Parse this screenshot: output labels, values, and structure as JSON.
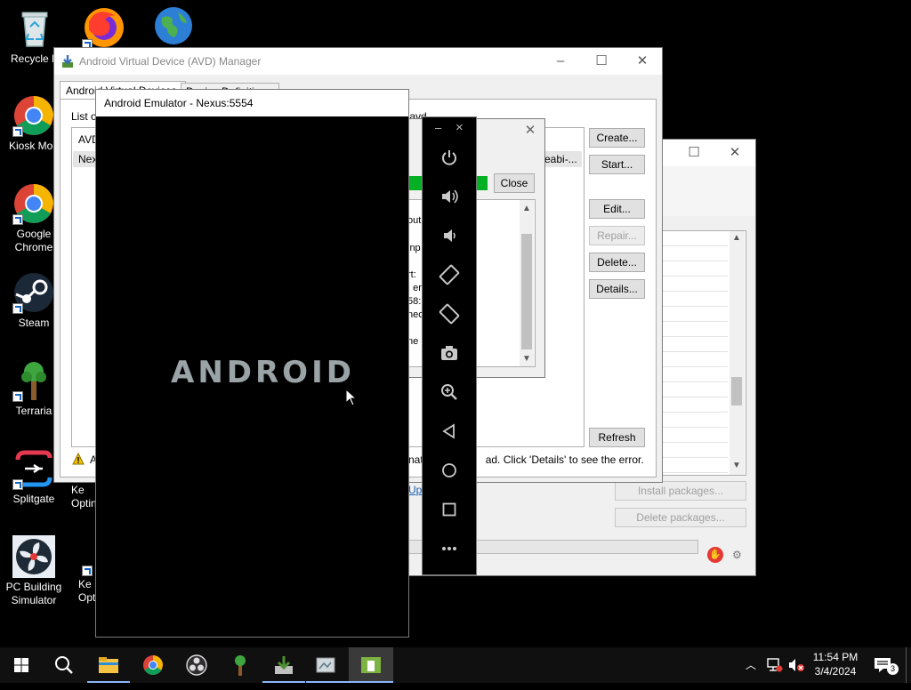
{
  "desktop": {
    "icons": [
      {
        "label": "Recycle B"
      },
      {
        "label": "Kiosk Mod"
      },
      {
        "label": "Google Chrome"
      },
      {
        "label": "Steam"
      },
      {
        "label": "Terraria"
      },
      {
        "label": "Splitgate"
      },
      {
        "label": "PC Building Simulator"
      },
      {
        "label": "Ke Optin"
      },
      {
        "label": "Ke Opt"
      }
    ]
  },
  "avd_manager": {
    "title": "Android Virtual Device (AVD) Manager",
    "tabs": [
      "Android Virtual Devices",
      "Device Definitions"
    ],
    "list_label": "List o",
    "path_fragment": "\\avd",
    "column_header": "AVD",
    "row_fragment": "Nex",
    "row_abi_fragment": "eabi-...",
    "buttons": {
      "create": "Create...",
      "start": "Start...",
      "edit": "Edit...",
      "repair": "Repair...",
      "delete": "Delete...",
      "details": "Details...",
      "refresh": "Refresh"
    },
    "warning_prefix": "A",
    "warning_text": "nat                     ad. Click 'Details' to see the error.",
    "link_fragment": "Upc"
  },
  "sdk_manager": {
    "install_packages": "Install packages...",
    "delete_packages": "Delete packages..."
  },
  "launch_dialog": {
    "close_button": "Close",
    "log_lines": [
      "out",
      "inp",
      "rt: ",
      ": er          4",
      "58:          ocess",
      "nec          ding.",
      "",
      "ne l          n,"
    ]
  },
  "emulator": {
    "title": "Android Emulator - Nexus:5554",
    "boot_text": "ANDROID",
    "toolbar": {
      "minimize": "–",
      "close": "×"
    }
  },
  "taskbar": {
    "time": "11:54 PM",
    "date": "3/4/2024",
    "notification_count": "3"
  }
}
